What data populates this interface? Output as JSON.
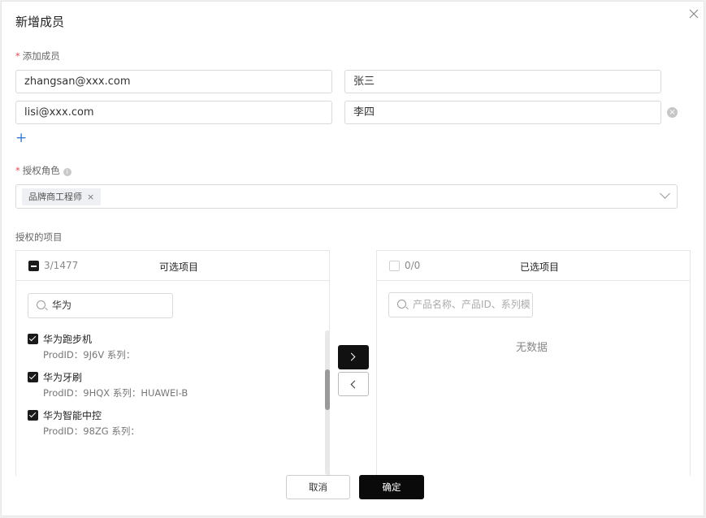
{
  "dialog": {
    "title": "新增成员"
  },
  "members": {
    "label": "添加成员",
    "rows": [
      {
        "email": "zhangsan@xxx.com",
        "name": "张三"
      },
      {
        "email": "lisi@xxx.com",
        "name": "李四"
      }
    ],
    "add_symbol": "+"
  },
  "role": {
    "label": "授权角色",
    "selected_tags": [
      "品牌商工程师"
    ],
    "tag_remove": "×"
  },
  "projects": {
    "label": "授权的项目",
    "source": {
      "count": "3/1477",
      "title": "可选项目",
      "search_value": "华为",
      "items": [
        {
          "name": "华为跑步机",
          "meta": "ProdID：9J6V 系列："
        },
        {
          "name": "华为牙刷",
          "meta": "ProdID：9HQX 系列：HUAWEI-B"
        },
        {
          "name": "华为智能中控",
          "meta": "ProdID：98ZG 系列："
        }
      ]
    },
    "target": {
      "count": "0/0",
      "title": "已选项目",
      "search_placeholder": "产品名称、产品ID、系列模",
      "empty_text": "无数据"
    }
  },
  "footer": {
    "cancel_label": "取消",
    "ok_label": "确定"
  }
}
